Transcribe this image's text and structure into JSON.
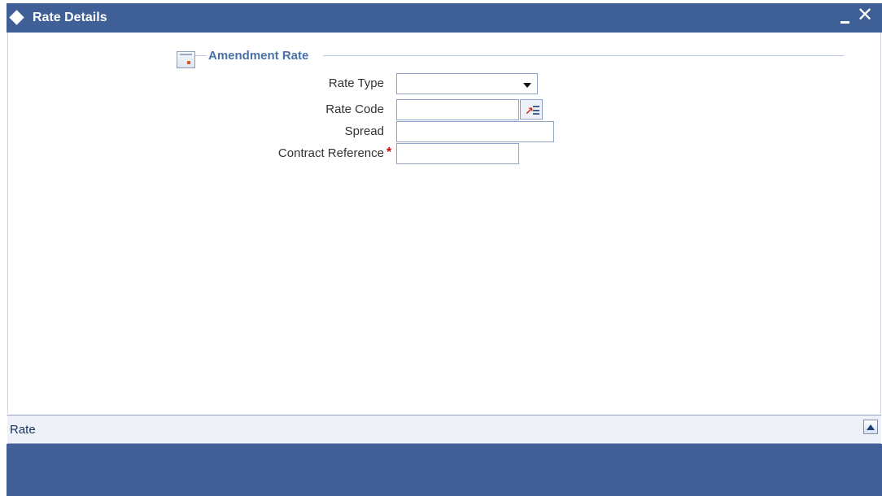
{
  "window": {
    "title": "Rate Details",
    "minimize_label": "",
    "close_label": "✕"
  },
  "section": {
    "title": "Amendment Rate"
  },
  "fields": {
    "rate_type": {
      "label": "Rate Type",
      "value": ""
    },
    "rate_code": {
      "label": "Rate Code",
      "value": ""
    },
    "spread": {
      "label": "Spread",
      "value": ""
    },
    "contract_reference": {
      "label": "Contract Reference",
      "required_marker": "*",
      "value": ""
    }
  },
  "tabs": [
    {
      "label": "Rate"
    }
  ],
  "icons": {
    "window": "diamond-icon",
    "section": "section-collapse-icon",
    "rate_code_lookup": "list-of-values-icon",
    "scroll": "scroll-up-icon"
  },
  "colors": {
    "titlebar": "#3f5f97",
    "section_title": "#4a70a8",
    "field_border": "#8ea4c8",
    "required": "#cc0000",
    "footer": "#435f98"
  }
}
